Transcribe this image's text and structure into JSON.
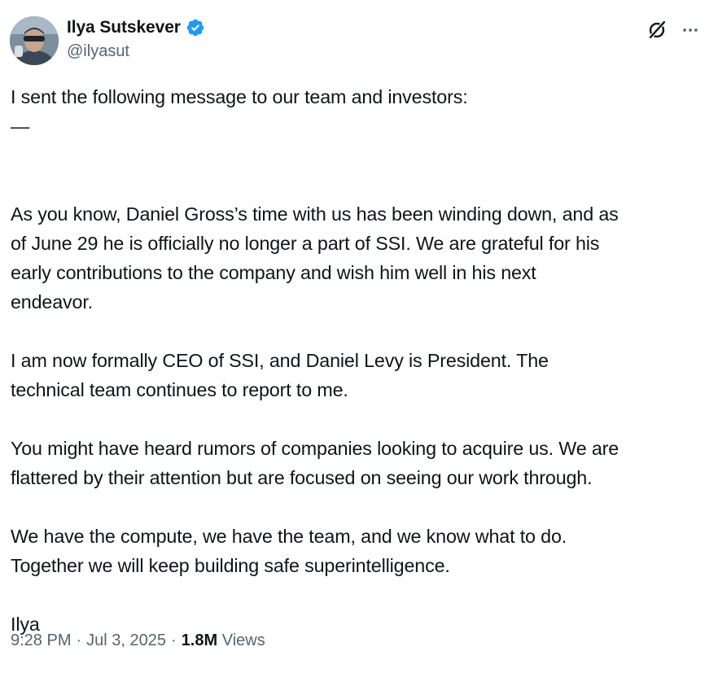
{
  "author": {
    "display_name": "Ilya Sutskever",
    "handle": "@ilyasut",
    "verified": true,
    "verified_color": "#1d9bf0"
  },
  "actions": {
    "grok_icon": "grok-icon",
    "more_icon": "more-icon"
  },
  "tweet": {
    "paragraphs": [
      [
        "I sent the following message to our team and investors:",
        "—"
      ],
      [
        "As you know, Daniel Gross’s time with us has been winding down, and as",
        "of June 29 he is officially no longer a part of SSI. We are grateful for his",
        "early contributions to the company and wish him well in his next",
        "endeavor."
      ],
      [
        "I am now formally CEO of SSI, and Daniel Levy is President. The",
        "technical team continues to report to me."
      ],
      [
        "You might have heard rumors of companies looking to acquire us. We are",
        "flattered by their attention but are focused on seeing our work through."
      ],
      [
        "We have the compute, we have the team, and we know what to do.",
        "Together we will keep building safe superintelligence."
      ],
      [
        "Ilya"
      ]
    ]
  },
  "meta": {
    "time": "9:28 PM",
    "date": "Jul 3, 2025",
    "separator": "·",
    "views_count": "1.8M",
    "views_label": "Views"
  },
  "colors": {
    "text_primary": "#0f1419",
    "text_secondary": "#536471",
    "accent": "#1d9bf0"
  }
}
